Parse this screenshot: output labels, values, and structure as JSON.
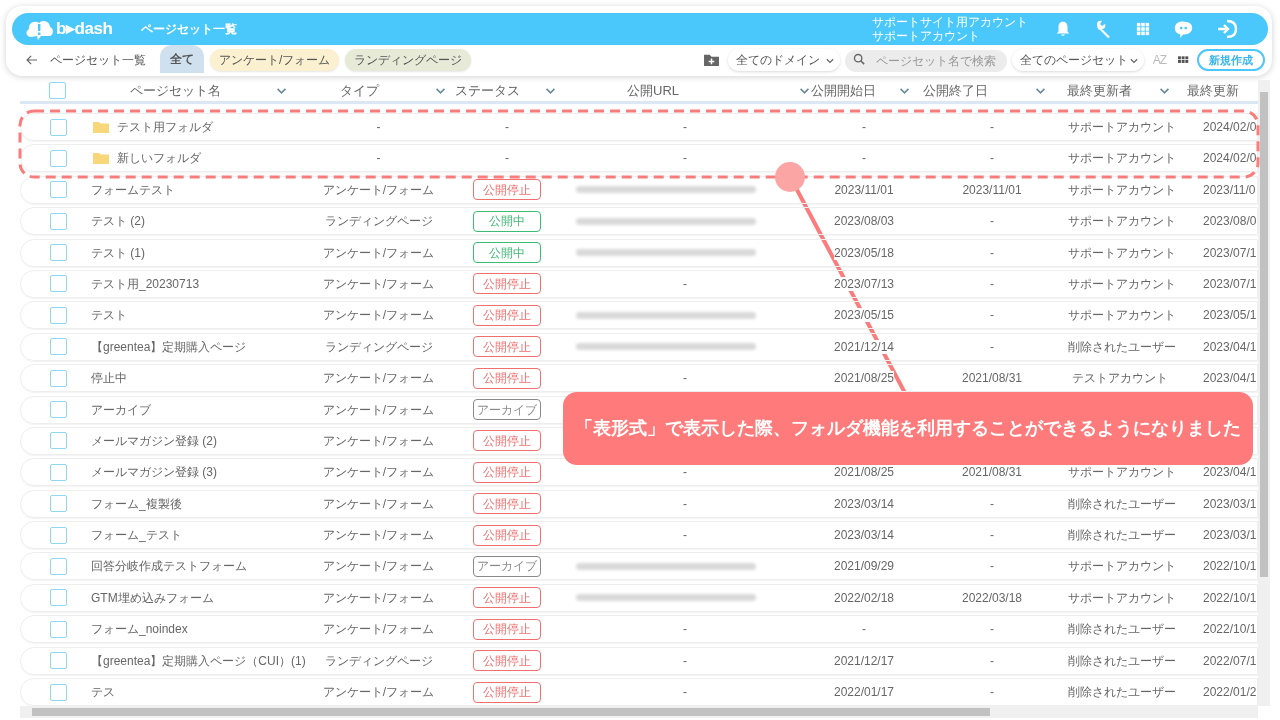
{
  "header": {
    "logo_text": "b▸dash",
    "page_title": "ページセット一覧",
    "account_lines": [
      "サポートサイト用アカウント",
      "サポートアカウント"
    ]
  },
  "toolbar": {
    "breadcrumb": "ページセット一覧",
    "tabs": [
      {
        "label": "全て",
        "selected": true,
        "color": "#cfe0ee"
      },
      {
        "label": "アンケート/フォーム",
        "selected": false,
        "color": "#fbf0cf"
      },
      {
        "label": "ランディングページ",
        "selected": false,
        "color": "#e6ead6"
      }
    ],
    "domain_select": "全てのドメイン",
    "search": {
      "placeholder": "ページセット名で検索"
    },
    "pageset_select": "全てのページセット",
    "sort_label": "AZ",
    "new_button": "新規作成"
  },
  "table": {
    "select_all_checked": false,
    "columns": [
      "ページセット名",
      "タイプ",
      "ステータス",
      "公開URL",
      "公開開始日",
      "公開終了日",
      "最終更新者",
      "最終更新"
    ],
    "rows": [
      {
        "kind": "folder",
        "checked": false,
        "name": "テスト用フォルダ",
        "type": "-",
        "status_text": "-",
        "url": "-",
        "start": "-",
        "end": "-",
        "updater": "サポートアカウント",
        "updated": "2024/02/0"
      },
      {
        "kind": "folder",
        "checked": false,
        "name": "新しいフォルダ",
        "type": "-",
        "status_text": "-",
        "url": "-",
        "start": "-",
        "end": "-",
        "updater": "サポートアカウント",
        "updated": "2024/02/0"
      },
      {
        "kind": "pageset",
        "checked": false,
        "name": "フォームテスト",
        "type": "アンケート/フォーム",
        "status": {
          "label": "公開停止",
          "color": "#f07070"
        },
        "url_redacted": true,
        "start": "2023/11/01",
        "end": "2023/11/01",
        "updater": "サポートアカウント",
        "updated": "2023/11/0"
      },
      {
        "kind": "pageset",
        "checked": false,
        "name": "テスト (2)",
        "type": "ランディングページ",
        "status": {
          "label": "公開中",
          "color": "#3dbb74"
        },
        "url_redacted": true,
        "start": "2023/08/03",
        "end": "-",
        "updater": "サポートアカウント",
        "updated": "2023/08/0"
      },
      {
        "kind": "pageset",
        "checked": false,
        "name": "テスト (1)",
        "type": "アンケート/フォーム",
        "status": {
          "label": "公開中",
          "color": "#3dbb74"
        },
        "url_redacted": true,
        "start": "2023/05/18",
        "end": "-",
        "updater": "サポートアカウント",
        "updated": "2023/07/1"
      },
      {
        "kind": "pageset",
        "checked": false,
        "name": "テスト用_20230713",
        "type": "アンケート/フォーム",
        "status": {
          "label": "公開停止",
          "color": "#f07070"
        },
        "url": "-",
        "start": "2023/07/13",
        "end": "-",
        "updater": "サポートアカウント",
        "updated": "2023/07/1"
      },
      {
        "kind": "pageset",
        "checked": false,
        "name": "テスト",
        "type": "アンケート/フォーム",
        "status": {
          "label": "公開停止",
          "color": "#f07070"
        },
        "url_redacted": true,
        "start": "2023/05/15",
        "end": "-",
        "updater": "サポートアカウント",
        "updated": "2023/05/1"
      },
      {
        "kind": "pageset",
        "checked": false,
        "name": "【greentea】定期購入ページ",
        "type": "ランディングページ",
        "status": {
          "label": "公開停止",
          "color": "#f07070"
        },
        "url_redacted": true,
        "start": "2021/12/14",
        "end": "-",
        "updater": "削除されたユーザー",
        "updated": "2023/04/1"
      },
      {
        "kind": "pageset",
        "checked": false,
        "name": "停止中",
        "type": "アンケート/フォーム",
        "status": {
          "label": "公開停止",
          "color": "#f07070"
        },
        "url": "-",
        "start": "2021/08/25",
        "end": "2021/08/31",
        "updater": "テストアカウント",
        "updated": "2023/04/1"
      },
      {
        "kind": "pageset",
        "checked": false,
        "name": "アーカイブ",
        "type": "アンケート/フォーム",
        "status": {
          "label": "アーカイブ",
          "color": "#8a8a8a"
        }
      },
      {
        "kind": "pageset",
        "checked": false,
        "name": "メールマガジン登録 (2)",
        "type": "アンケート/フォーム",
        "status": {
          "label": "公開停止",
          "color": "#f07070"
        }
      },
      {
        "kind": "pageset",
        "checked": false,
        "name": "メールマガジン登録 (3)",
        "type": "アンケート/フォーム",
        "status": {
          "label": "公開停止",
          "color": "#f07070"
        },
        "url": "-",
        "start": "2021/08/25",
        "end": "2021/08/31",
        "updater": "サポートアカウント",
        "updated": "2023/04/1"
      },
      {
        "kind": "pageset",
        "checked": false,
        "name": "フォーム_複製後",
        "type": "アンケート/フォーム",
        "status": {
          "label": "公開停止",
          "color": "#f07070"
        },
        "url": "-",
        "start": "2023/03/14",
        "end": "-",
        "updater": "削除されたユーザー",
        "updated": "2023/03/1"
      },
      {
        "kind": "pageset",
        "checked": false,
        "name": "フォーム_テスト",
        "type": "アンケート/フォーム",
        "status": {
          "label": "公開停止",
          "color": "#f07070"
        },
        "url": "-",
        "start": "2023/03/14",
        "end": "-",
        "updater": "削除されたユーザー",
        "updated": "2023/03/1"
      },
      {
        "kind": "pageset",
        "checked": false,
        "name": "回答分岐作成テストフォーム",
        "type": "アンケート/フォーム",
        "status": {
          "label": "アーカイブ",
          "color": "#8a8a8a"
        },
        "url_redacted": true,
        "start": "2021/09/29",
        "end": "-",
        "updater": "サポートアカウント",
        "updated": "2022/10/1"
      },
      {
        "kind": "pageset",
        "checked": false,
        "name": "GTM埋め込みフォーム",
        "type": "アンケート/フォーム",
        "status": {
          "label": "公開停止",
          "color": "#f07070"
        },
        "url_redacted": true,
        "start": "2022/02/18",
        "end": "2022/03/18",
        "updater": "サポートアカウント",
        "updated": "2022/10/1"
      },
      {
        "kind": "pageset",
        "checked": false,
        "name": "フォーム_noindex",
        "type": "アンケート/フォーム",
        "status": {
          "label": "公開停止",
          "color": "#f07070"
        },
        "url": "-",
        "start": "-",
        "end": "-",
        "updater": "削除されたユーザー",
        "updated": "2022/10/1"
      },
      {
        "kind": "pageset",
        "checked": false,
        "name": "【greentea】定期購入ページ（CUI）(1)",
        "type": "ランディングページ",
        "status": {
          "label": "公開停止",
          "color": "#f07070"
        },
        "url": "-",
        "start": "2021/12/17",
        "end": "-",
        "updater": "削除されたユーザー",
        "updated": "2022/07/1"
      },
      {
        "kind": "pageset",
        "checked": false,
        "name": "テス",
        "type": "アンケート/フォーム",
        "status": {
          "label": "公開停止",
          "color": "#f07070"
        },
        "url": "-",
        "start": "2022/01/17",
        "end": "-",
        "updater": "削除されたユーザー",
        "updated": "2022/01/2"
      }
    ]
  },
  "callout": {
    "text": "「表形式」で表示した際、フォルダ機能を利用することができるようになりました"
  }
}
